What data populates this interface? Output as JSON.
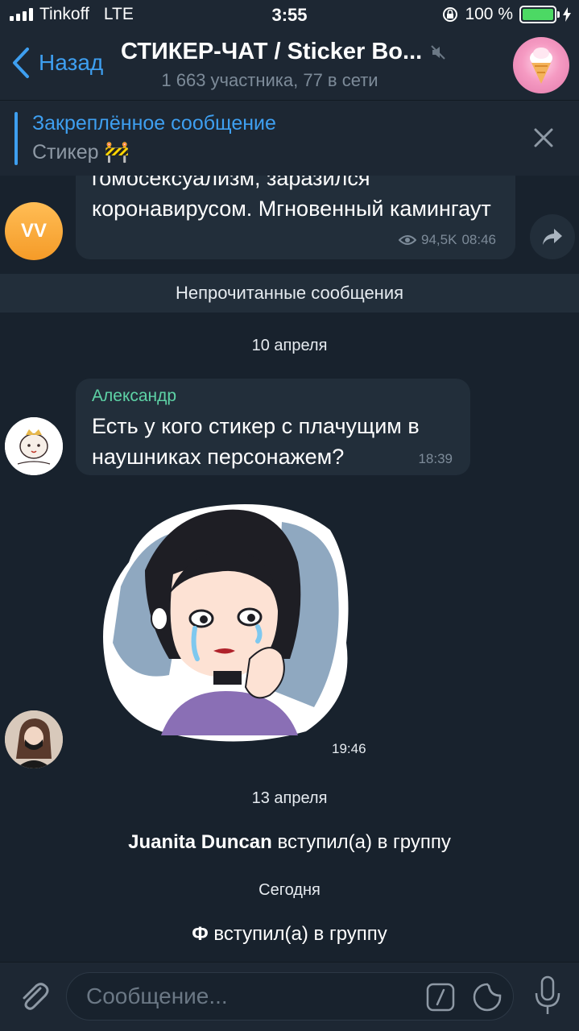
{
  "status": {
    "carrier": "Tinkoff",
    "network": "LTE",
    "time": "3:55",
    "battery": "100 %"
  },
  "header": {
    "back_label": "Назад",
    "title": "СТИКЕР-ЧАТ / Sticker Bo...",
    "subtitle": "1 663 участника, 77 в сети"
  },
  "pinned": {
    "title": "Закреплённое сообщение",
    "text": "Стикер 🚧"
  },
  "messages": {
    "m1": {
      "avatar": "VV",
      "text": "гомосексуализм, заразился коронавирусом. Мгновенный камингаут",
      "views": "94,5K",
      "time": "08:46"
    },
    "unread_label": "Непрочитанные сообщения",
    "date1": "10 апреля",
    "m2": {
      "author": "Александр",
      "text": "Есть у кого стикер с плачущим в наушниках персонажем?",
      "time": "18:39"
    },
    "m3": {
      "time": "19:46"
    },
    "date2": "13 апреля",
    "join1": {
      "name": "Juanita Duncan",
      "action": "вступил(а) в группу"
    },
    "date3": "Сегодня",
    "join2": {
      "name": "Ф",
      "action": "вступил(а) в группу"
    }
  },
  "input": {
    "placeholder": "Сообщение..."
  },
  "colors": {
    "accent": "#3e9ff0",
    "author": "#5ed3a6",
    "bg": "#18222d",
    "bubble": "#222e3a"
  }
}
